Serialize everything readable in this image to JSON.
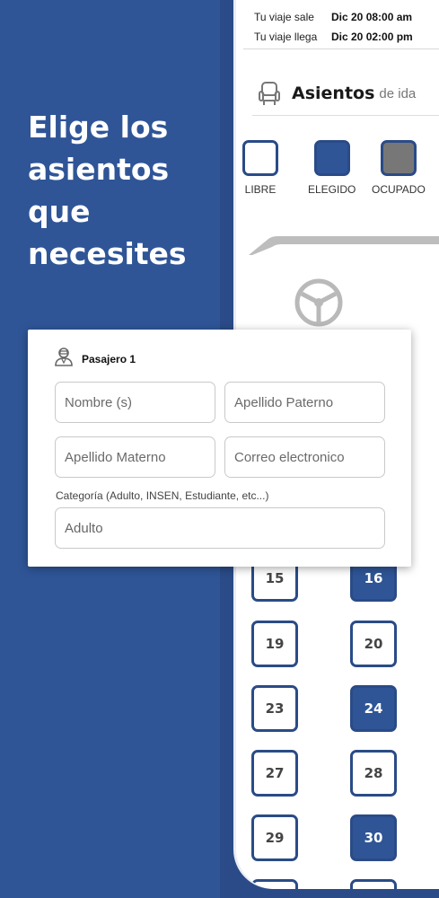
{
  "headline": {
    "line1": "Elige los",
    "line2": "asientos",
    "line3": "que",
    "line4": "necesites"
  },
  "trip": {
    "depart_label": "Tu viaje sale",
    "depart_value": "Dic 20 08:00 am",
    "arrive_label": "Tu viaje llega",
    "arrive_value": "Dic 20 02:00 pm"
  },
  "seats_header": {
    "title": "Asientos",
    "subtitle": "de ida",
    "icon": "seat-icon"
  },
  "legend": {
    "free": {
      "label": "LIBRE",
      "color": "#ffffff"
    },
    "chosen": {
      "label": "ELEGIDO",
      "color": "#2f5597"
    },
    "occupied": {
      "label": "OCUPADO",
      "color": "#777777"
    }
  },
  "seats": [
    {
      "number": "15",
      "state": "libre"
    },
    {
      "number": "16",
      "state": "elegido"
    },
    {
      "number": "19",
      "state": "libre"
    },
    {
      "number": "20",
      "state": "libre"
    },
    {
      "number": "23",
      "state": "libre"
    },
    {
      "number": "24",
      "state": "elegido"
    },
    {
      "number": "27",
      "state": "libre"
    },
    {
      "number": "28",
      "state": "libre"
    },
    {
      "number": "29",
      "state": "libre"
    },
    {
      "number": "30",
      "state": "elegido"
    }
  ],
  "form": {
    "passenger_label": "Pasajero 1",
    "passenger_icon": "user-icon",
    "name_placeholder": "Nombre (s)",
    "paternal_placeholder": "Apellido Paterno",
    "maternal_placeholder": "Apellido Materno",
    "email_placeholder": "Correo electronico",
    "category_label": "Categoría (Adulto, INSEN, Estudiante, etc...)",
    "category_value": "Adulto"
  },
  "colors": {
    "brand_blue": "#2f5597",
    "dark_blue": "#2a4b87",
    "occupied_gray": "#777777"
  }
}
